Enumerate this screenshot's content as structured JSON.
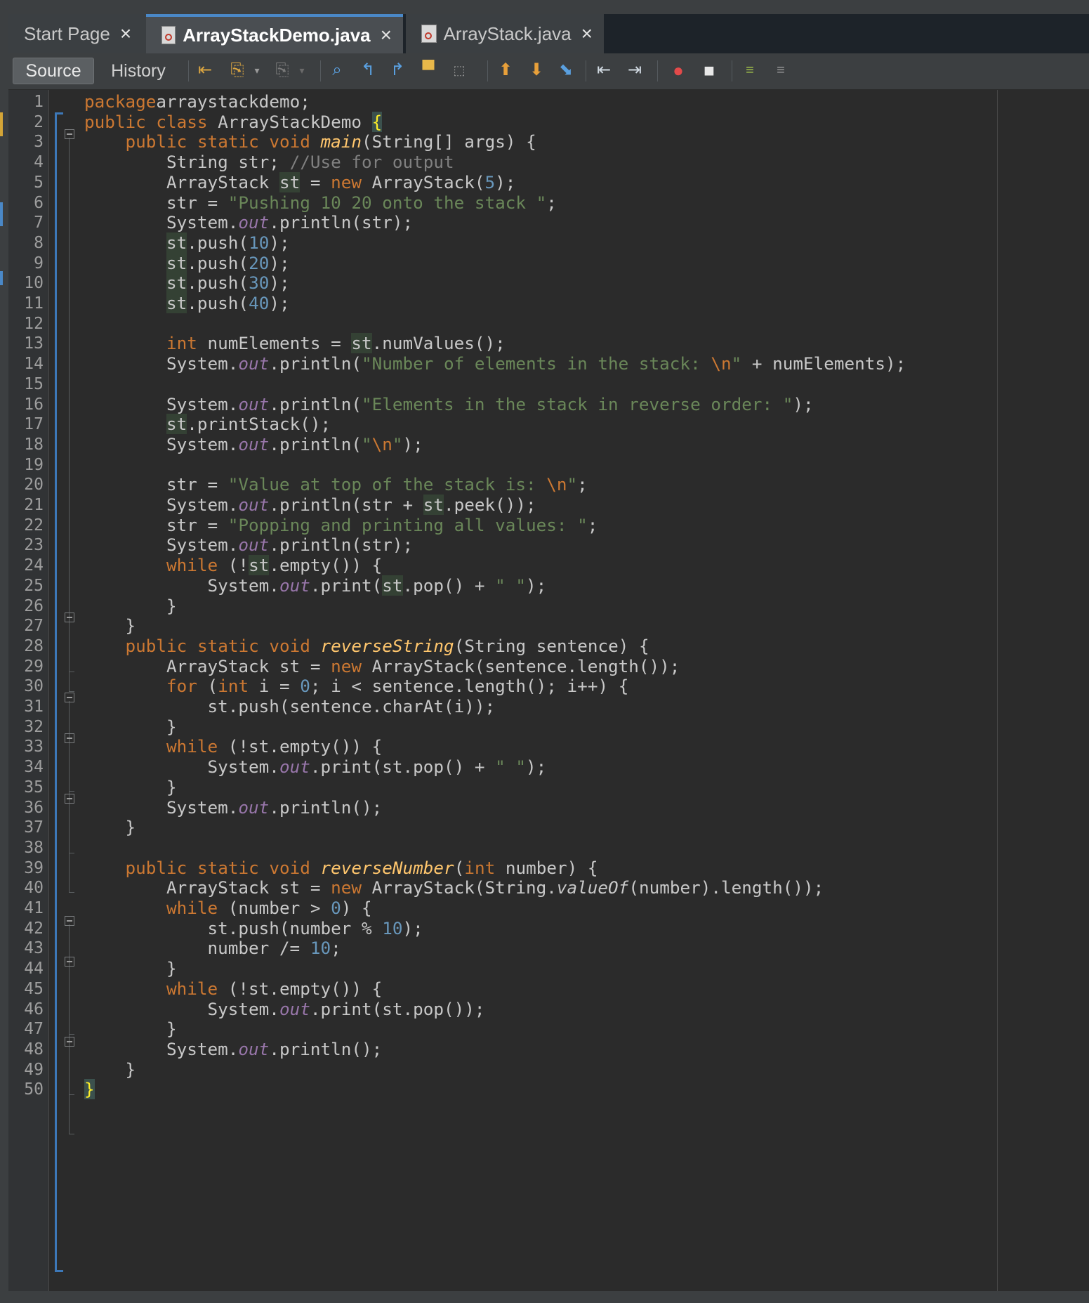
{
  "tabs": [
    {
      "label": "Start Page",
      "close": "×",
      "active": false
    },
    {
      "label": "ArrayStackDemo.java",
      "close": "×",
      "active": true
    },
    {
      "label": "ArrayStack.java",
      "close": "×",
      "active": false
    }
  ],
  "toolbar": {
    "source_label": "Source",
    "history_label": "History",
    "icons": [
      "last-edit-icon",
      "back-icon",
      "forward-icon",
      "find-icon",
      "find-previous-icon",
      "find-next-icon",
      "find-selection-icon",
      "toggle-highlight-icon",
      "previous-bookmark-icon",
      "next-bookmark-icon",
      "toggle-bookmark-icon",
      "shift-left-icon",
      "shift-right-icon",
      "start-macro-icon",
      "stop-macro-icon",
      "comment-icon",
      "uncomment-icon"
    ]
  },
  "colors": {
    "keyword": "#cc7832",
    "method_decl": "#ffc66d",
    "field": "#9876aa",
    "string": "#6a8759",
    "number": "#6897bb",
    "comment": "#808080",
    "text": "#c8c8c8",
    "background": "#2b2b2b",
    "accent": "#4a88c7"
  },
  "editor": {
    "lines": [
      {
        "n": "1",
        "tokens": [
          [
            "kw",
            "package"
          ],
          [
            "",
            "arraystackdemo;"
          ]
        ]
      },
      {
        "n": "2",
        "tokens": [
          [
            "kw",
            "public"
          ],
          [
            "",
            " "
          ],
          [
            "kw",
            "class"
          ],
          [
            "",
            " ArrayStackDemo "
          ],
          [
            "brace",
            "{"
          ]
        ]
      },
      {
        "n": "3",
        "tokens": [
          [
            "",
            "    "
          ],
          [
            "kw",
            "public"
          ],
          [
            "",
            " "
          ],
          [
            "kw",
            "static"
          ],
          [
            "",
            " "
          ],
          [
            "kw",
            "void"
          ],
          [
            "",
            " "
          ],
          [
            "fn",
            "main"
          ],
          [
            "",
            "(String[] args) {"
          ]
        ]
      },
      {
        "n": "4",
        "tokens": [
          [
            "",
            "        String str; "
          ],
          [
            "cmt",
            "//Use for output"
          ]
        ]
      },
      {
        "n": "5",
        "tokens": [
          [
            "",
            "        ArrayStack "
          ],
          [
            "var",
            "st"
          ],
          [
            "",
            " = "
          ],
          [
            "kw",
            "new"
          ],
          [
            "",
            " ArrayStack("
          ],
          [
            "num",
            "5"
          ],
          [
            "",
            ");"
          ]
        ]
      },
      {
        "n": "6",
        "tokens": [
          [
            "",
            "        str = "
          ],
          [
            "str",
            "\"Pushing 10 20 onto the stack \""
          ],
          [
            "",
            ";"
          ]
        ]
      },
      {
        "n": "7",
        "tokens": [
          [
            "",
            "        System."
          ],
          [
            "fld",
            "out"
          ],
          [
            "",
            ".println(str);"
          ]
        ]
      },
      {
        "n": "8",
        "tokens": [
          [
            "",
            "        "
          ],
          [
            "var",
            "st"
          ],
          [
            "",
            ".push("
          ],
          [
            "num",
            "10"
          ],
          [
            "",
            ");"
          ]
        ]
      },
      {
        "n": "9",
        "tokens": [
          [
            "",
            "        "
          ],
          [
            "var",
            "st"
          ],
          [
            "",
            ".push("
          ],
          [
            "num",
            "20"
          ],
          [
            "",
            ");"
          ]
        ]
      },
      {
        "n": "10",
        "tokens": [
          [
            "",
            "        "
          ],
          [
            "var",
            "st"
          ],
          [
            "",
            ".push("
          ],
          [
            "num",
            "30"
          ],
          [
            "",
            ");"
          ]
        ]
      },
      {
        "n": "11",
        "tokens": [
          [
            "",
            "        "
          ],
          [
            "var",
            "st"
          ],
          [
            "",
            ".push("
          ],
          [
            "num",
            "40"
          ],
          [
            "",
            ");"
          ]
        ]
      },
      {
        "n": "12",
        "tokens": []
      },
      {
        "n": "13",
        "tokens": [
          [
            "",
            "        "
          ],
          [
            "kw",
            "int"
          ],
          [
            "",
            " numElements = "
          ],
          [
            "var",
            "st"
          ],
          [
            "",
            ".numValues();"
          ]
        ]
      },
      {
        "n": "14",
        "tokens": [
          [
            "",
            "        System."
          ],
          [
            "fld",
            "out"
          ],
          [
            "",
            ".println("
          ],
          [
            "str",
            "\"Number of elements in the stack: "
          ],
          [
            "esc",
            "\\n"
          ],
          [
            "str",
            "\""
          ],
          [
            "",
            " + numElements);"
          ]
        ]
      },
      {
        "n": "15",
        "tokens": []
      },
      {
        "n": "16",
        "tokens": [
          [
            "",
            "        System."
          ],
          [
            "fld",
            "out"
          ],
          [
            "",
            ".println("
          ],
          [
            "str",
            "\"Elements in the stack in reverse order: \""
          ],
          [
            "",
            ");"
          ]
        ]
      },
      {
        "n": "17",
        "tokens": [
          [
            "",
            "        "
          ],
          [
            "var",
            "st"
          ],
          [
            "",
            ".printStack();"
          ]
        ]
      },
      {
        "n": "18",
        "tokens": [
          [
            "",
            "        System."
          ],
          [
            "fld",
            "out"
          ],
          [
            "",
            ".println("
          ],
          [
            "str",
            "\""
          ],
          [
            "esc",
            "\\n"
          ],
          [
            "str",
            "\""
          ],
          [
            "",
            ");"
          ]
        ]
      },
      {
        "n": "19",
        "tokens": []
      },
      {
        "n": "20",
        "tokens": [
          [
            "",
            "        str = "
          ],
          [
            "str",
            "\"Value at top of the stack is: "
          ],
          [
            "esc",
            "\\n"
          ],
          [
            "str",
            "\""
          ],
          [
            "",
            ";"
          ]
        ]
      },
      {
        "n": "21",
        "tokens": [
          [
            "",
            "        System."
          ],
          [
            "fld",
            "out"
          ],
          [
            "",
            ".println(str + "
          ],
          [
            "var",
            "st"
          ],
          [
            "",
            ".peek());"
          ]
        ]
      },
      {
        "n": "22",
        "tokens": [
          [
            "",
            "        str = "
          ],
          [
            "str",
            "\"Popping and printing all values: \""
          ],
          [
            "",
            ";"
          ]
        ]
      },
      {
        "n": "23",
        "tokens": [
          [
            "",
            "        System."
          ],
          [
            "fld",
            "out"
          ],
          [
            "",
            ".println(str);"
          ]
        ]
      },
      {
        "n": "24",
        "tokens": [
          [
            "",
            "        "
          ],
          [
            "kw",
            "while"
          ],
          [
            "",
            " (!"
          ],
          [
            "var",
            "st"
          ],
          [
            "",
            ".empty()) {"
          ]
        ]
      },
      {
        "n": "25",
        "tokens": [
          [
            "",
            "            System."
          ],
          [
            "fld",
            "out"
          ],
          [
            "",
            ".print("
          ],
          [
            "var",
            "st"
          ],
          [
            "",
            ".pop() + "
          ],
          [
            "str",
            "\" \""
          ],
          [
            "",
            ");"
          ]
        ]
      },
      {
        "n": "26",
        "tokens": [
          [
            "",
            "        }"
          ]
        ]
      },
      {
        "n": "27",
        "tokens": [
          [
            "",
            "    }"
          ]
        ]
      },
      {
        "n": "28",
        "tokens": [
          [
            "",
            "    "
          ],
          [
            "kw",
            "public"
          ],
          [
            "",
            " "
          ],
          [
            "kw",
            "static"
          ],
          [
            "",
            " "
          ],
          [
            "kw",
            "void"
          ],
          [
            "",
            " "
          ],
          [
            "fn",
            "reverseString"
          ],
          [
            "",
            "(String sentence) {"
          ]
        ]
      },
      {
        "n": "29",
        "tokens": [
          [
            "",
            "        ArrayStack st = "
          ],
          [
            "kw",
            "new"
          ],
          [
            "",
            " ArrayStack(sentence.length());"
          ]
        ]
      },
      {
        "n": "30",
        "tokens": [
          [
            "",
            "        "
          ],
          [
            "kw",
            "for"
          ],
          [
            "",
            " ("
          ],
          [
            "kw",
            "int"
          ],
          [
            "",
            " i = "
          ],
          [
            "num",
            "0"
          ],
          [
            "",
            "; i < sentence.length(); i++) {"
          ]
        ]
      },
      {
        "n": "31",
        "tokens": [
          [
            "",
            "            st.push(sentence.charAt(i));"
          ]
        ]
      },
      {
        "n": "32",
        "tokens": [
          [
            "",
            "        }"
          ]
        ]
      },
      {
        "n": "33",
        "tokens": [
          [
            "",
            "        "
          ],
          [
            "kw",
            "while"
          ],
          [
            "",
            " (!st.empty()) {"
          ]
        ]
      },
      {
        "n": "34",
        "tokens": [
          [
            "",
            "            System."
          ],
          [
            "fld",
            "out"
          ],
          [
            "",
            ".print(st.pop() + "
          ],
          [
            "str",
            "\" \""
          ],
          [
            "",
            ");"
          ]
        ]
      },
      {
        "n": "35",
        "tokens": [
          [
            "",
            "        }"
          ]
        ]
      },
      {
        "n": "36",
        "tokens": [
          [
            "",
            "        System."
          ],
          [
            "fld",
            "out"
          ],
          [
            "",
            ".println();"
          ]
        ]
      },
      {
        "n": "37",
        "tokens": [
          [
            "",
            "    }"
          ]
        ]
      },
      {
        "n": "38",
        "tokens": []
      },
      {
        "n": "39",
        "tokens": [
          [
            "",
            "    "
          ],
          [
            "kw",
            "public"
          ],
          [
            "",
            " "
          ],
          [
            "kw",
            "static"
          ],
          [
            "",
            " "
          ],
          [
            "kw",
            "void"
          ],
          [
            "",
            " "
          ],
          [
            "fn",
            "reverseNumber"
          ],
          [
            "",
            "("
          ],
          [
            "kw",
            "int"
          ],
          [
            "",
            " number) {"
          ]
        ]
      },
      {
        "n": "40",
        "tokens": [
          [
            "",
            "        ArrayStack st = "
          ],
          [
            "kw",
            "new"
          ],
          [
            "",
            " ArrayStack(String."
          ],
          [
            "mth",
            "valueOf"
          ],
          [
            "",
            "(number).length());"
          ]
        ]
      },
      {
        "n": "41",
        "tokens": [
          [
            "",
            "        "
          ],
          [
            "kw",
            "while"
          ],
          [
            "",
            " (number > "
          ],
          [
            "num",
            "0"
          ],
          [
            "",
            ") {"
          ]
        ]
      },
      {
        "n": "42",
        "tokens": [
          [
            "",
            "            st.push(number % "
          ],
          [
            "num",
            "10"
          ],
          [
            "",
            ");"
          ]
        ]
      },
      {
        "n": "43",
        "tokens": [
          [
            "",
            "            number /= "
          ],
          [
            "num",
            "10"
          ],
          [
            "",
            ";"
          ]
        ]
      },
      {
        "n": "44",
        "tokens": [
          [
            "",
            "        }"
          ]
        ]
      },
      {
        "n": "45",
        "tokens": [
          [
            "",
            "        "
          ],
          [
            "kw",
            "while"
          ],
          [
            "",
            " (!st.empty()) {"
          ]
        ]
      },
      {
        "n": "46",
        "tokens": [
          [
            "",
            "            System."
          ],
          [
            "fld",
            "out"
          ],
          [
            "",
            ".print(st.pop());"
          ]
        ]
      },
      {
        "n": "47",
        "tokens": [
          [
            "",
            "        }"
          ]
        ]
      },
      {
        "n": "48",
        "tokens": [
          [
            "",
            "        System."
          ],
          [
            "fld",
            "out"
          ],
          [
            "",
            ".println();"
          ]
        ]
      },
      {
        "n": "49",
        "tokens": [
          [
            "",
            "    }"
          ]
        ]
      },
      {
        "n": "50",
        "tokens": [
          [
            "brace",
            "}"
          ]
        ]
      }
    ]
  }
}
